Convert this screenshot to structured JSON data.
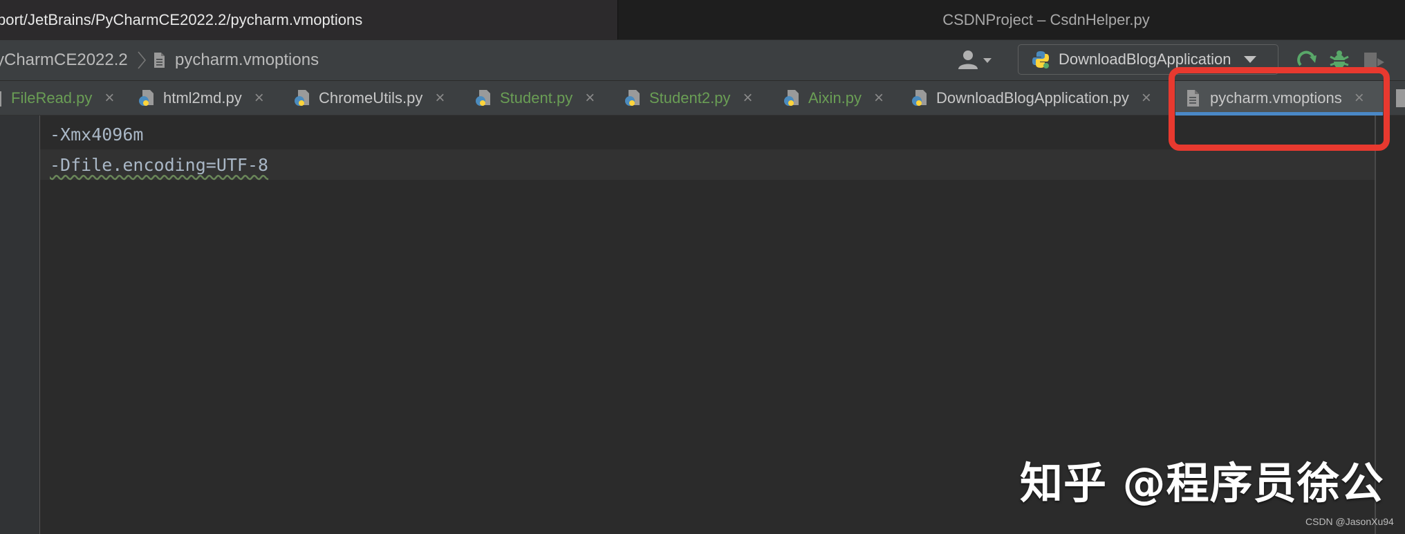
{
  "window": {
    "path_title": "port/JetBrains/PyCharmCE2022.2/pycharm.vmoptions",
    "project_title": "CSDNProject – CsdnHelper.py"
  },
  "breadcrumb": {
    "items": [
      "yCharmCE2022.2",
      "pycharm.vmoptions"
    ]
  },
  "toolbar": {
    "run_configuration": "DownloadBlogApplication"
  },
  "tabs": [
    {
      "label": "FileRead.py",
      "color": "#6a9e55",
      "icon": "python-file-icon"
    },
    {
      "label": "html2md.py",
      "color": "#c8c8c8",
      "icon": "python-file-icon"
    },
    {
      "label": "ChromeUtils.py",
      "color": "#c8c8c8",
      "icon": "python-file-icon"
    },
    {
      "label": "Student.py",
      "color": "#6a9e55",
      "icon": "python-file-icon"
    },
    {
      "label": "Student2.py",
      "color": "#6a9e55",
      "icon": "python-file-icon"
    },
    {
      "label": "Aixin.py",
      "color": "#6a9e55",
      "icon": "python-file-icon"
    },
    {
      "label": "DownloadBlogApplication.py",
      "color": "#c8c8c8",
      "icon": "python-file-icon"
    },
    {
      "label": "pycharm.vmoptions",
      "color": "#c8c8c8",
      "icon": "text-file-icon",
      "active": true
    }
  ],
  "tab_close_glyph": "×",
  "editor": {
    "lines": [
      "-Xmx4096m",
      "-Dfile.encoding=UTF-8"
    ]
  },
  "colors": {
    "highlight_border": "#e8392f",
    "tab_underline": "#4a88c7",
    "modified_tab_text": "#6a9e55"
  },
  "watermark": {
    "zhihu": "知乎 @程序员徐公",
    "csdn": "CSDN @JasonXu94"
  }
}
